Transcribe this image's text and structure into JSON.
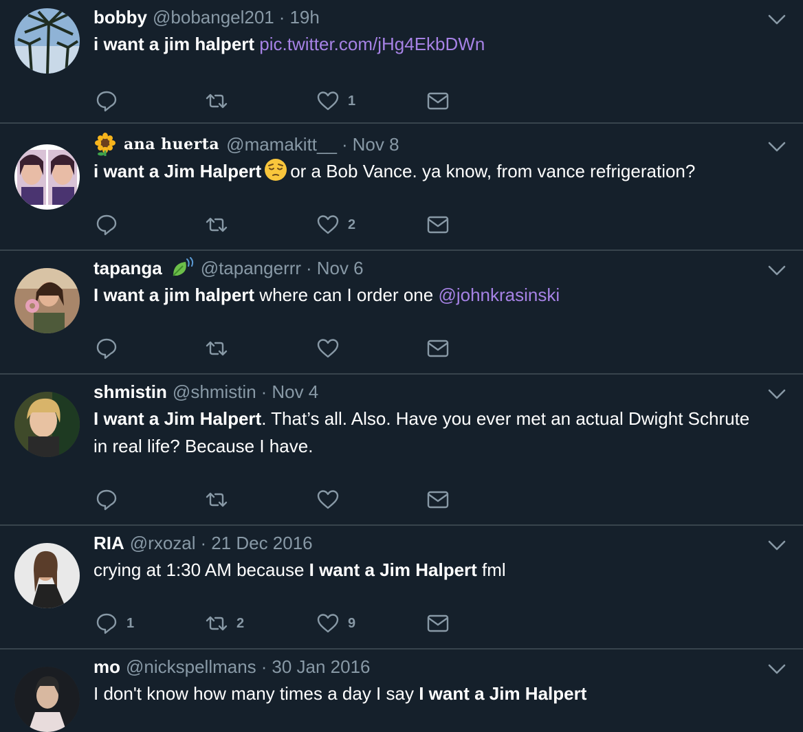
{
  "colors": {
    "background": "#15202b",
    "divider": "#38444d",
    "muted": "#8899a6",
    "link": "#a682e5"
  },
  "tweets": [
    {
      "name": "bobby",
      "handle": "@bobangel201",
      "time": "19h",
      "text_bold": "i want a jim halpert",
      "link": "pic.twitter.com/jHg4EkbDWn",
      "reply_count": "",
      "retweet_count": "",
      "like_count": "1"
    },
    {
      "name_prefix_icon": "sunflower-emoji",
      "name": "ana huerta",
      "handle": "@mamakitt__",
      "time": "Nov 8",
      "text_bold": "i want a Jim Halpert",
      "emoji": "pensive-face-emoji",
      "text_rest": "or a Bob Vance. ya know, from vance refrigeration?",
      "reply_count": "",
      "retweet_count": "",
      "like_count": "2"
    },
    {
      "name": "tapanga",
      "name_suffix_icon": "leaf-fluttering-in-wind-emoji",
      "handle": "@tapangerrr",
      "time": "Nov 6",
      "text_bold": "I want a jim halpert",
      "text_rest": " where can I order one ",
      "mention": "@johnkrasinski",
      "reply_count": "",
      "retweet_count": "",
      "like_count": ""
    },
    {
      "name": "shmistin",
      "handle": "@shmistin",
      "time": "Nov 4",
      "text_bold": "I want a Jim Halpert",
      "text_rest": ". That’s all. Also. Have you ever met an actual Dwight Schrute in real life? Because I have.",
      "reply_count": "",
      "retweet_count": "",
      "like_count": ""
    },
    {
      "name": "RIA",
      "handle": "@rxozal",
      "time": "21 Dec 2016",
      "text_pre": "crying at 1:30 AM because ",
      "text_bold": "I want a Jim Halpert",
      "text_rest": " fml",
      "reply_count": "1",
      "retweet_count": "2",
      "like_count": "9"
    },
    {
      "name": "mo",
      "handle": "@nickspellmans",
      "time": "30 Jan 2016",
      "text_pre": "I don't know how many times a day I say ",
      "text_bold": "I want a Jim Halpert"
    }
  ]
}
